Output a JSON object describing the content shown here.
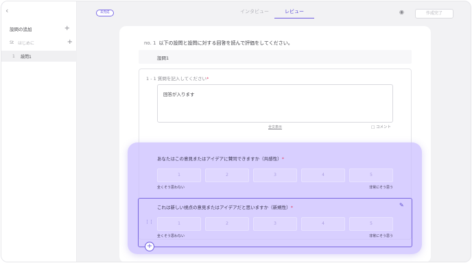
{
  "sidebar": {
    "back_icon": "chevron-left-icon",
    "heading": "設問の追加",
    "items": [
      {
        "num": "St",
        "label": "はじめに"
      },
      {
        "num": "1",
        "label": "設問1"
      }
    ]
  },
  "topbar": {
    "badge": "未完成",
    "tabs": [
      "インタビュー",
      "レビュー"
    ],
    "active_tab": "レビュー",
    "eye_icon": "eye-icon",
    "done_button": "作成完了"
  },
  "question": {
    "number": "no. 1",
    "instruction": "以下の設問と設問に対する回答を読んで評価をしてください。",
    "section_label": "設問1",
    "sub_number": "1 - 1",
    "prompt": "質問を記入してください",
    "required_mark": "*",
    "answer": "回答が入ります",
    "full_view_link": "全文表示",
    "comment_label": "コメント"
  },
  "criteria": [
    {
      "title": "あなたはこの意見またはアイデアに賛同できますか（共感性）",
      "required_mark": "*",
      "options": [
        "1",
        "2",
        "3",
        "4",
        "5"
      ],
      "low_anchor": "全くそう思わない",
      "high_anchor": "非常にそう思う"
    },
    {
      "title": "これは新しい視点の意見またはアイデアだと思いますか（新規性）",
      "required_mark": "*",
      "options": [
        "1",
        "2",
        "3",
        "4",
        "5"
      ],
      "low_anchor": "全くそう思わない",
      "high_anchor": "非常にそう思う"
    }
  ],
  "colors": {
    "accent": "#6e5de0",
    "highlight": "#c9bcff",
    "required": "#e0436a"
  }
}
